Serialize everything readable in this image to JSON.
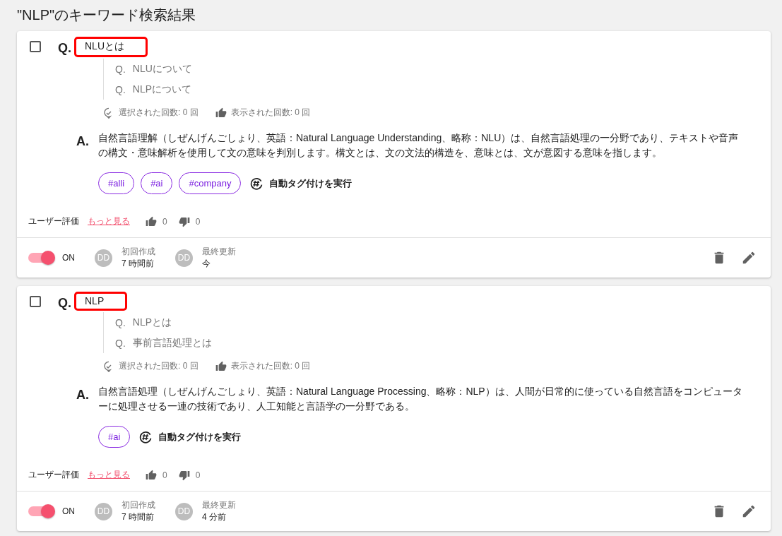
{
  "title": "\"NLP\"のキーワード検索結果",
  "cards": [
    {
      "checked": false,
      "question_label": "Q.",
      "question": "NLUとは",
      "highlighted": true,
      "alternates": [
        {
          "label": "Q.",
          "text": "NLUについて"
        },
        {
          "label": "Q.",
          "text": "NLPについて"
        }
      ],
      "selected_count": "選択された回数: 0 回",
      "shown_count": "表示された回数: 0 回",
      "answer_label": "A.",
      "answer": "自然言語理解（しぜんげんごしょり、英語：Natural Language Understanding、略称：NLU）は、自然言語処理の一分野であり、テキストや音声の構文・意味解析を使用して文の意味を判別します。構文とは、文の文法的構造を、意味とは、文が意図する意味を指します。",
      "tags": [
        "#alli",
        "#ai",
        "#company"
      ],
      "auto_tag": "自動タグ付けを実行",
      "rating_label": "ユーザー評価",
      "more_link": "もっと見る",
      "likes": "0",
      "dislikes": "0",
      "enabled": true,
      "toggle_label": "ON",
      "created": {
        "avatar": "DD",
        "label": "初回作成",
        "value": "7 時間前"
      },
      "updated": {
        "avatar": "DD",
        "label": "最終更新",
        "value": "今"
      }
    },
    {
      "checked": false,
      "question_label": "Q.",
      "question": "NLP",
      "highlighted": true,
      "alternates": [
        {
          "label": "Q.",
          "text": "NLPとは"
        },
        {
          "label": "Q.",
          "text": "事前言語処理とは"
        }
      ],
      "selected_count": "選択された回数: 0 回",
      "shown_count": "表示された回数: 0 回",
      "answer_label": "A.",
      "answer": "自然言語処理（しぜんげんごしょり、英語：Natural Language Processing、略称：NLP）は、人間が日常的に使っている自然言語をコンピューターに処理させる一連の技術であり、人工知能と言語学の一分野である。",
      "tags": [
        "#ai"
      ],
      "auto_tag": "自動タグ付けを実行",
      "rating_label": "ユーザー評価",
      "more_link": "もっと見る",
      "likes": "0",
      "dislikes": "0",
      "enabled": true,
      "toggle_label": "ON",
      "created": {
        "avatar": "DD",
        "label": "初回作成",
        "value": "7 時間前"
      },
      "updated": {
        "avatar": "DD",
        "label": "最終更新",
        "value": "4 分前"
      }
    }
  ]
}
